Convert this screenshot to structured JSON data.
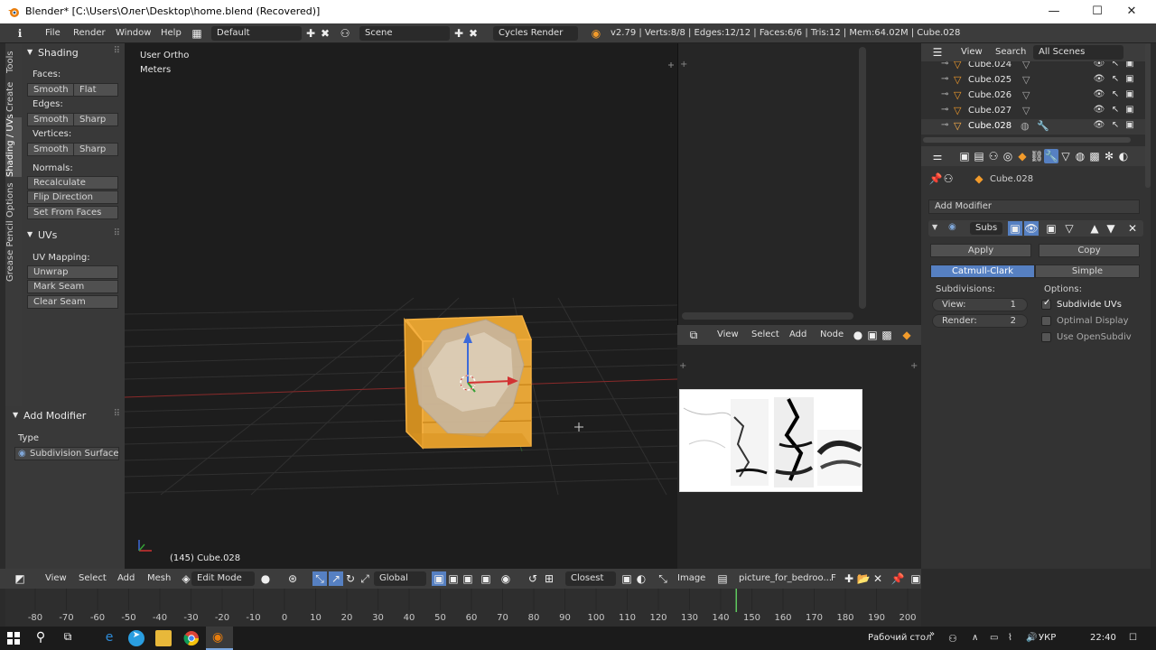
{
  "window": {
    "title": "Blender* [C:\\Users\\Олег\\Desktop\\home.blend (Recovered)]",
    "minimize": "—",
    "maximize": "☐",
    "close": "✕"
  },
  "info_header": {
    "menus": [
      "File",
      "Render",
      "Window",
      "Help"
    ],
    "layout": "Default",
    "scene": "Scene",
    "engine": "Cycles Render",
    "stats": "v2.79 | Verts:8/8 | Edges:12/12 | Faces:6/6 | Tris:12 | Mem:64.02M | Cube.028"
  },
  "tabs": {
    "tools": "Tools",
    "create": "Create",
    "shading": "Shading / UVs",
    "options": "Options",
    "grease": "Grease Pencil"
  },
  "shading_panel": {
    "title": "Shading",
    "faces_label": "Faces:",
    "faces_smooth": "Smooth",
    "faces_flat": "Flat",
    "edges_label": "Edges:",
    "edges_smooth": "Smooth",
    "edges_sharp": "Sharp",
    "vertices_label": "Vertices:",
    "vertices_smooth": "Smooth",
    "vertices_sharp": "Sharp",
    "normals_label": "Normals:",
    "recalculate": "Recalculate",
    "flip": "Flip Direction",
    "set_from_faces": "Set From Faces"
  },
  "uvs_panel": {
    "title": "UVs",
    "mapping_label": "UV Mapping:",
    "unwrap": "Unwrap",
    "mark_seam": "Mark Seam",
    "clear_seam": "Clear Seam"
  },
  "operator_panel": {
    "title": "Add Modifier",
    "type_label": "Type",
    "type_value": "Subdivision Surface"
  },
  "viewport": {
    "view_name": "User Ortho",
    "units": "Meters",
    "object_info": "(145) Cube.028"
  },
  "outliner": {
    "view": "View",
    "search": "Search",
    "filter": "All Scenes",
    "rows": [
      "Cube.024",
      "Cube.025",
      "Cube.026",
      "Cube.027",
      "Cube.028"
    ]
  },
  "properties": {
    "object_name": "Cube.028",
    "add_modifier": "Add Modifier",
    "modifier_name": "Subs",
    "apply": "Apply",
    "copy": "Copy",
    "catmull": "Catmull-Clark",
    "simple": "Simple",
    "subdivisions_label": "Subdivisions:",
    "view_label": "View:",
    "view_value": "1",
    "render_label": "Render:",
    "render_value": "2",
    "options_label": "Options:",
    "subdivide_uvs": "Subdivide UVs",
    "optimal_display": "Optimal Display",
    "use_opensubdiv": "Use OpenSubdiv"
  },
  "node_header": {
    "view": "View",
    "select": "Select",
    "add": "Add",
    "node": "Node"
  },
  "bottom_header": {
    "view": "View",
    "select": "Select",
    "add": "Add",
    "mesh": "Mesh",
    "mode": "Edit Mode",
    "orientation": "Global",
    "snap": "Closest",
    "image_menu": "Image",
    "image_name": "picture_for_bedroo...",
    "image_flag": "F"
  },
  "timeline": {
    "ticks": [
      "-80",
      "-70",
      "-60",
      "-50",
      "-40",
      "-30",
      "-20",
      "-10",
      "0",
      "10",
      "20",
      "30",
      "40",
      "50",
      "60",
      "70",
      "80",
      "90",
      "100",
      "110",
      "120",
      "130",
      "140",
      "150",
      "160",
      "170",
      "180",
      "190",
      "200"
    ],
    "current_frame": 145
  },
  "taskbar": {
    "desktop": "Рабочий стол",
    "lang": "УКР",
    "time": "22:40"
  },
  "colors": {
    "accent_blue": "#5680c2",
    "orange": "#f29b2b"
  }
}
